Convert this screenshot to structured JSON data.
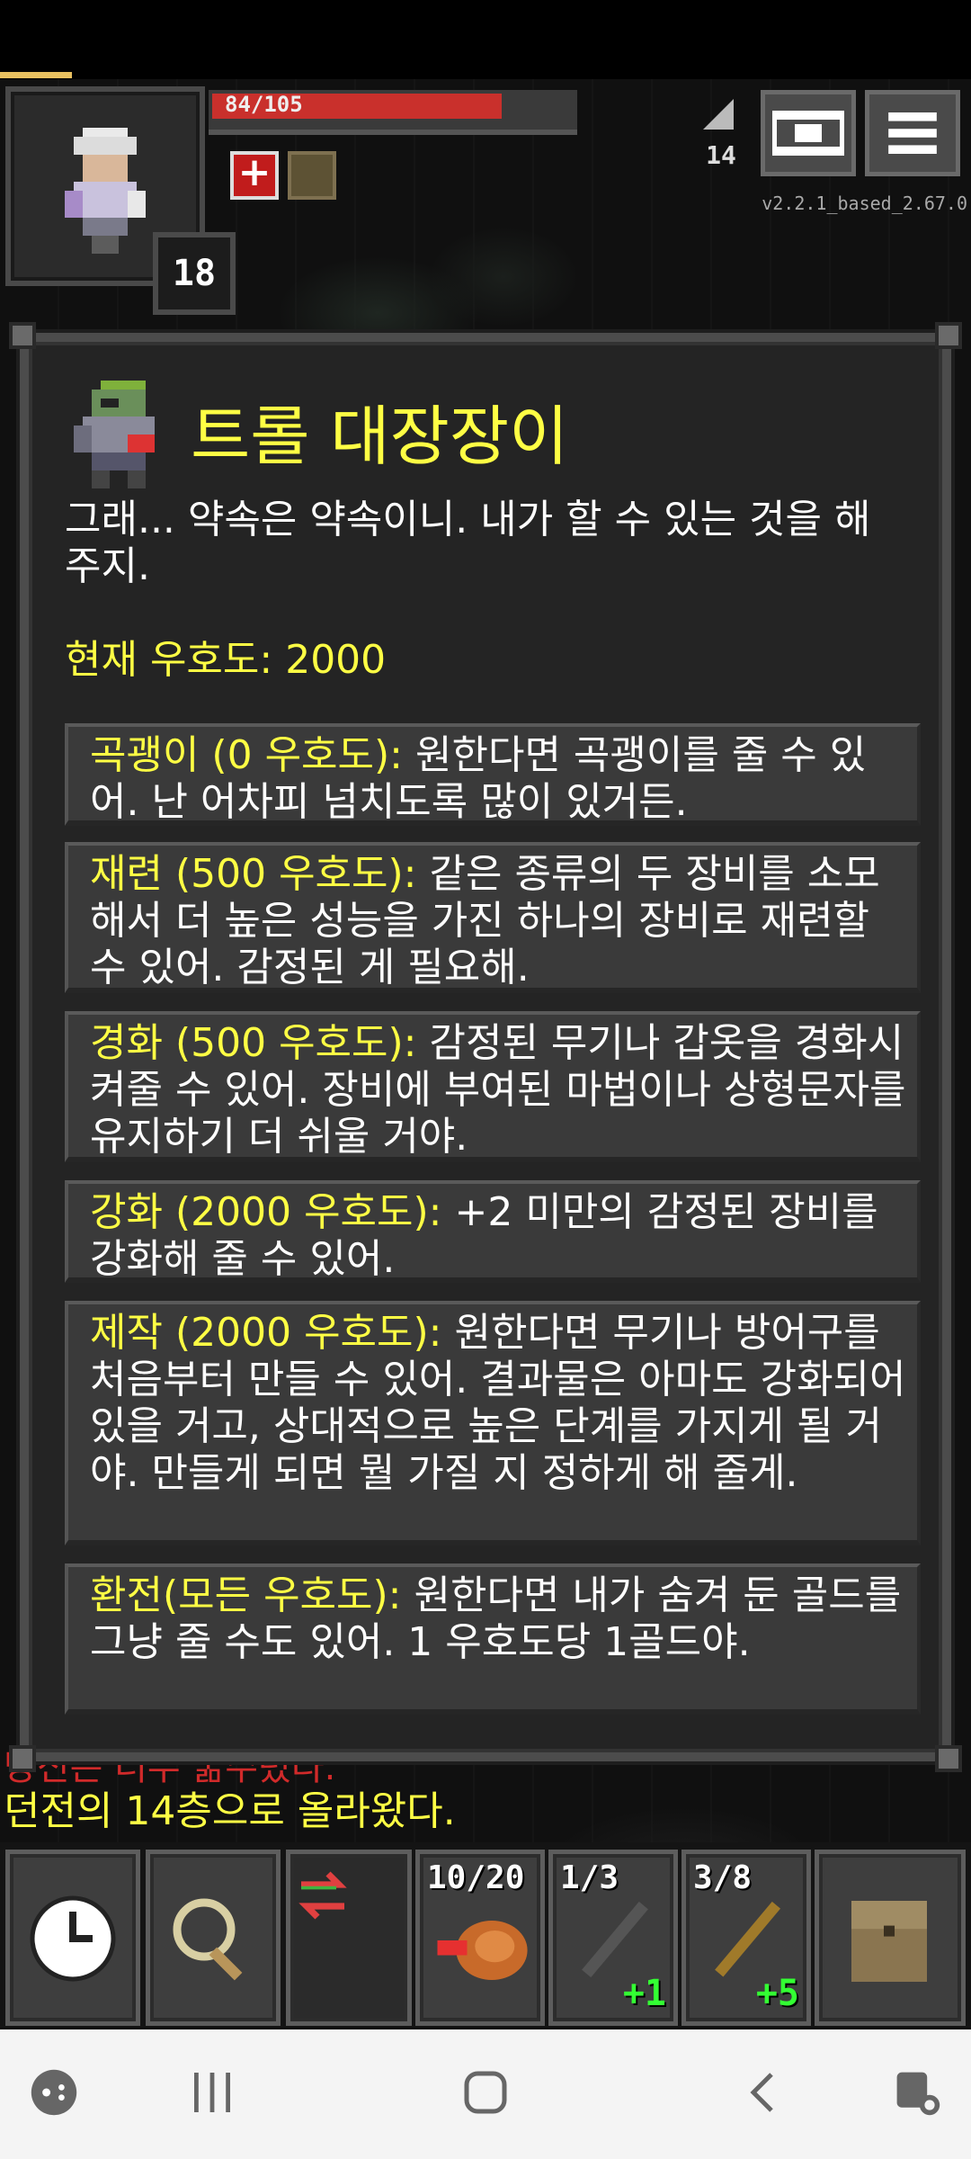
{
  "hud": {
    "hp": "84/105",
    "hp_fraction": 0.8,
    "level": "18",
    "depth": "14",
    "version": "v2.2.1_based_2.67.0"
  },
  "dialog": {
    "npc_name": "트롤 대장장이",
    "npc_text": "그래... 약속은 약속이니. 내가 할 수 있는 것을 해 주지.",
    "favor_label": "현재 우호도: 2000",
    "options": [
      {
        "title": "곡괭이 (0 우호도):",
        "text": " 원한다면 곡괭이를 줄 수 있어. 난 어차피 넘치도록 많이 있거든."
      },
      {
        "title": "재련 (500 우호도):",
        "text": " 같은 종류의 두 장비를 소모해서 더 높은 성능을 가진 하나의 장비로 재련할 수 있어. 감정된 게 필요해."
      },
      {
        "title": "경화 (500 우호도):",
        "text": " 감정된 무기나 갑옷을 경화시켜줄 수 있어. 장비에 부여된 마법이나 상형문자를 유지하기 더 쉬울 거야."
      },
      {
        "title": "강화 (2000 우호도):",
        "text": " +2 미만의 감정된 장비를 강화해 줄 수 있어."
      },
      {
        "title": "제작 (2000 우호도):",
        "text": " 원한다면 무기나 방어구를 처음부터 만들 수 있어. 결과물은 아마도 강화되어 있을 거고, 상대적으로 높은 단계를 가지게 될 거야. 만들게 되면 뭘 가질 지 정하게 해 줄게."
      },
      {
        "title": "환전(모든 우호도):",
        "text": " 원한다면 내가 숨겨 둔 골드를 그냥 줄 수도 있어. 1 우호도당 1골드야."
      }
    ]
  },
  "log": {
    "line1": "당신은 너무 굶주렸다.",
    "line2": "던전의 14층으로 올라왔다."
  },
  "toolbar": {
    "quickslots": [
      {
        "count": "10/20",
        "bonus": ""
      },
      {
        "count": "1/3",
        "bonus": "+1"
      },
      {
        "count": "3/8",
        "bonus": "+5"
      }
    ]
  },
  "icons": [
    "clock-icon",
    "magnifier-icon",
    "swap-icon",
    "meat-icon",
    "wand-icon",
    "staff-icon",
    "backpack-icon",
    "journal-icon",
    "menu-icon",
    "stairs-icon"
  ]
}
